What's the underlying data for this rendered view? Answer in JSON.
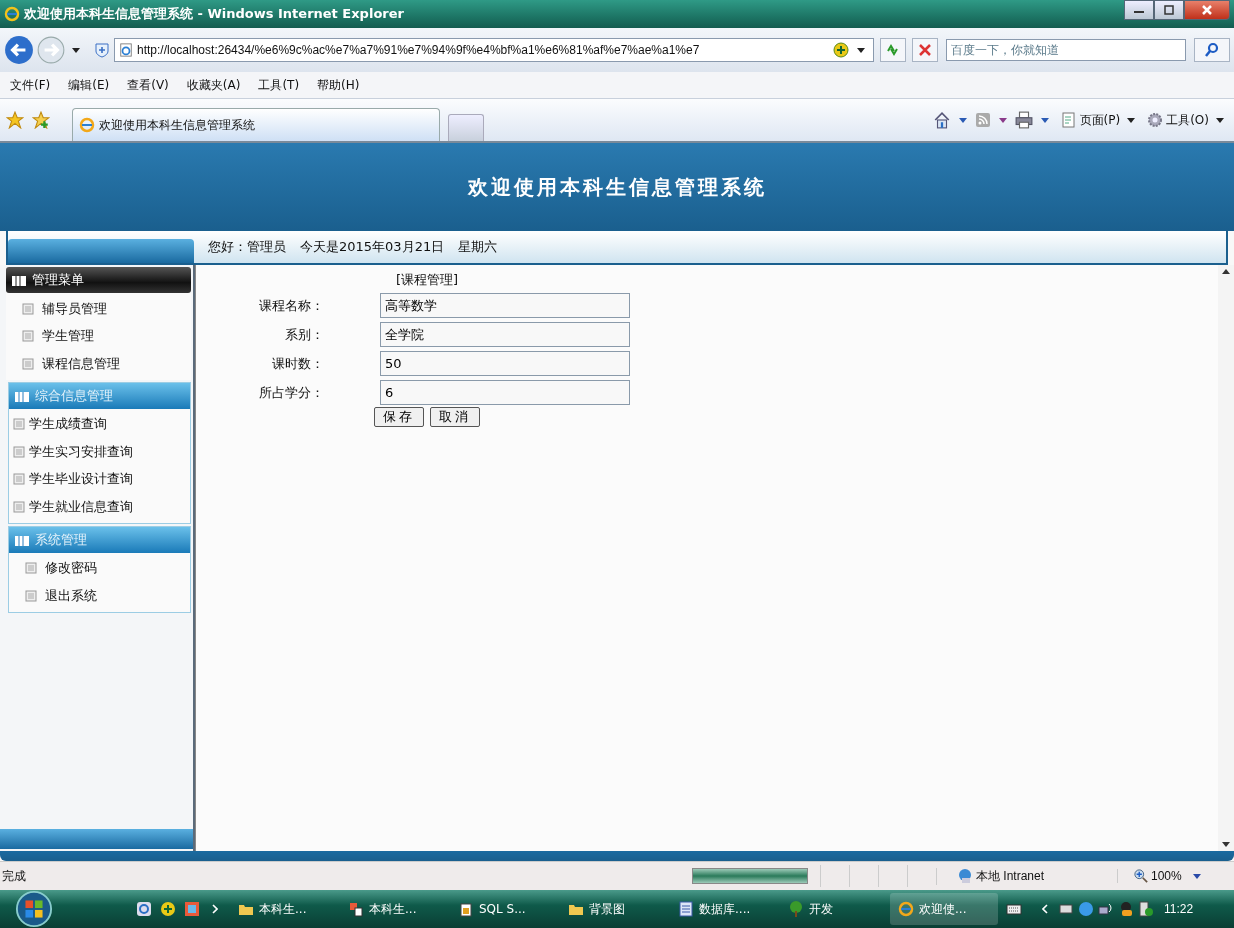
{
  "window": {
    "title": "欢迎使用本科生信息管理系统 - Windows Internet Explorer"
  },
  "nav": {
    "url": "http://localhost:26434/%e6%9c%ac%e7%a7%91%e7%94%9f%e4%bf%a1%e6%81%af%e7%ae%a1%e7",
    "search_placeholder": "百度一下，你就知道"
  },
  "menu": [
    "文件(F)",
    "编辑(E)",
    "查看(V)",
    "收藏夹(A)",
    "工具(T)",
    "帮助(H)"
  ],
  "tab": {
    "title": "欢迎使用本科生信息管理系统"
  },
  "command_bar": [
    "页面(P)",
    "工具(O)"
  ],
  "page": {
    "header": "欢迎使用本科生信息管理系统",
    "greeting": [
      "您好：管理员",
      "今天是2015年03月21日",
      "星期六"
    ],
    "sidebar": [
      {
        "title": "管理菜单",
        "kind": "dark",
        "items": [
          "辅导员管理",
          "学生管理",
          "课程信息管理"
        ]
      },
      {
        "title": "综合信息管理",
        "kind": "blue",
        "items": [
          "学生成绩查询",
          "学生实习安排查询",
          "学生毕业设计查询",
          "学生就业信息查询"
        ]
      },
      {
        "title": "系统管理",
        "kind": "blue",
        "items": [
          "修改密码",
          "退出系统"
        ]
      }
    ],
    "form": {
      "title": "[课程管理]",
      "fields": [
        {
          "label": "课程名称：",
          "value": "高等数学"
        },
        {
          "label": "系别：",
          "value": "全学院"
        },
        {
          "label": "课时数：",
          "value": "50"
        },
        {
          "label": "所占学分：",
          "value": "6"
        }
      ],
      "buttons": [
        "保存",
        "取消"
      ]
    }
  },
  "status_bar": {
    "text": "完成",
    "progress": {
      "level": 1
    },
    "zone": "本地 Intranet",
    "zoom": "100%"
  },
  "taskbar": {
    "items": [
      {
        "label": "本科生...",
        "kind": "folder",
        "selected": false
      },
      {
        "label": "本科生...",
        "kind": "app",
        "selected": false
      },
      {
        "label": "SQL S...",
        "kind": "db",
        "selected": false
      },
      {
        "label": "背景图",
        "kind": "folder",
        "selected": false
      },
      {
        "label": "数据库....",
        "kind": "doc",
        "selected": false
      },
      {
        "label": "开发",
        "kind": "tree",
        "selected": false
      },
      {
        "label": "欢迎使...",
        "kind": "ie",
        "selected": true
      }
    ],
    "clock": "11:22"
  }
}
